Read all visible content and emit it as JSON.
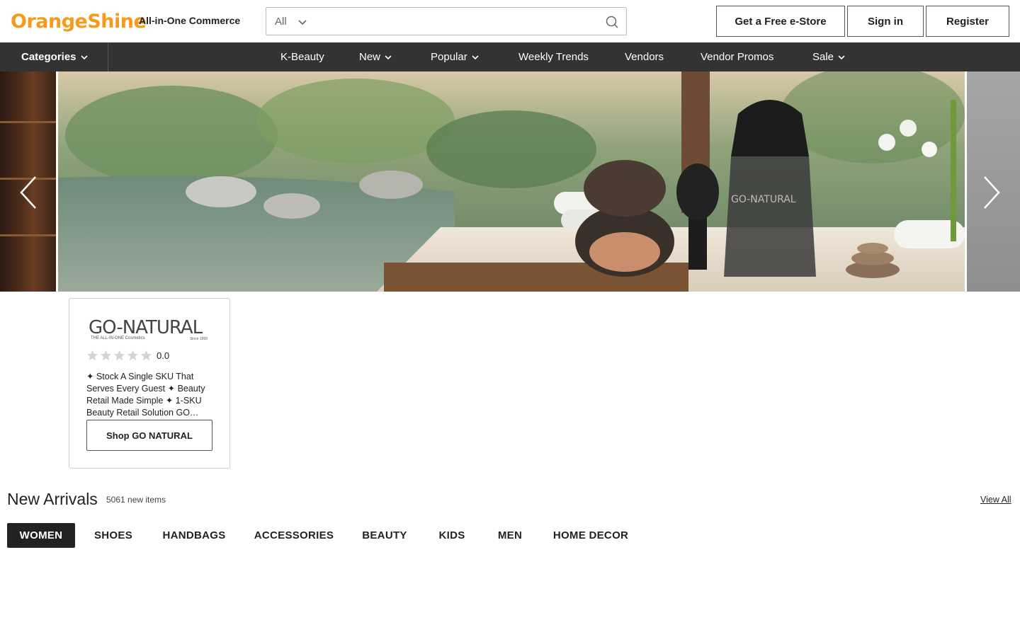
{
  "header": {
    "logo_text": "OrangeShine",
    "tagline": "All-in-One Commerce",
    "search": {
      "category": "All",
      "placeholder": ""
    },
    "buttons": {
      "estore": "Get a Free e-Store",
      "signin": "Sign in",
      "register": "Register"
    }
  },
  "nav": {
    "categories_label": "Categories",
    "items": [
      {
        "label": "K-Beauty",
        "dropdown": false
      },
      {
        "label": "New",
        "dropdown": true
      },
      {
        "label": "Popular",
        "dropdown": true
      },
      {
        "label": "Weekly Trends",
        "dropdown": false
      },
      {
        "label": "Vendors",
        "dropdown": false
      },
      {
        "label": "Vendor Promos",
        "dropdown": false
      },
      {
        "label": "Sale",
        "dropdown": true
      }
    ]
  },
  "banner": {
    "product_logo": "GO-NATURAL"
  },
  "vendor_card": {
    "logo_text": "GO-NATURAL",
    "logo_sub": "THE ALL-IN-ONE Cosmetics",
    "logo_since": "Since 1999",
    "rating": "0.0",
    "stars_filled": 0,
    "stars_total": 5,
    "description": "✦ Stock A Single SKU That Serves Every Guest ✦ Beauty Retail Made Simple ✦ 1-SKU Beauty Retail Solution GO…",
    "button": "Shop GO NATURAL"
  },
  "new_arrivals": {
    "title": "New Arrivals",
    "count": "5061 new items",
    "view_all": "View All",
    "tabs": [
      "WOMEN",
      "SHOES",
      "HANDBAGS",
      "ACCESSORIES",
      "BEAUTY",
      "KIDS",
      "MEN",
      "HOME DECOR"
    ],
    "active_tab": "WOMEN"
  },
  "colors": {
    "brand_orange": "#f59a1b",
    "nav_bg": "#333333",
    "active_tab_bg": "#222222"
  }
}
